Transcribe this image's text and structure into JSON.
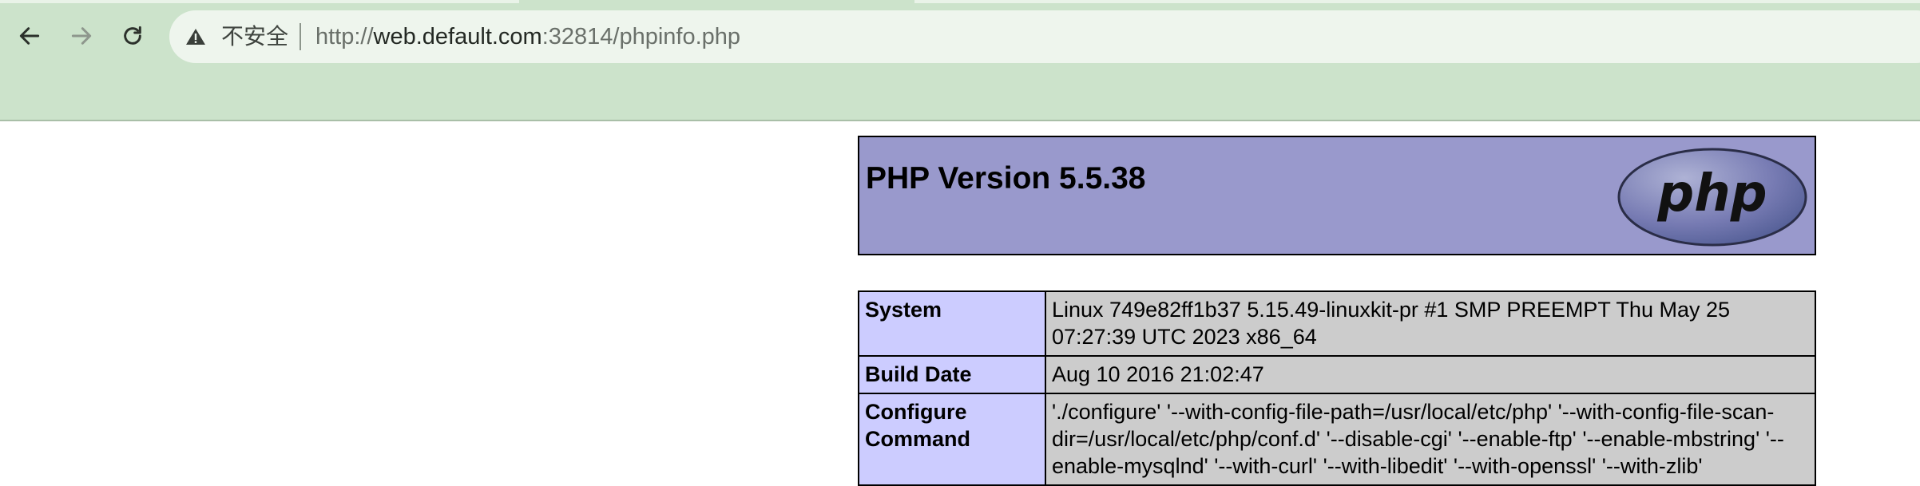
{
  "browser": {
    "security_label": "不安全",
    "url_scheme": "http://",
    "url_host": "web.default.com",
    "url_rest": ":32814/phpinfo.php",
    "icons": [
      "back-arrow-icon",
      "forward-arrow-icon",
      "reload-icon",
      "warning-icon"
    ]
  },
  "php": {
    "title": "PHP Version 5.5.38",
    "logo_text": "php",
    "rows": [
      {
        "key": "System",
        "value": "Linux 749e82ff1b37 5.15.49-linuxkit-pr #1 SMP PREEMPT Thu May 25 07:27:39 UTC 2023 x86_64"
      },
      {
        "key": "Build Date",
        "value": "Aug 10 2016 21:02:47"
      },
      {
        "key": "Configure Command",
        "value": "'./configure' '--with-config-file-path=/usr/local/etc/php' '--with-config-file-scan-dir=/usr/local/etc/php/conf.d' '--disable-cgi' '--enable-ftp' '--enable-mbstring' '--enable-mysqlnd' '--with-curl' '--with-libedit' '--with-openssl' '--with-zlib'"
      }
    ]
  },
  "colors": {
    "chrome_bg": "#cce3cb",
    "omnibox_bg": "#eef5ed",
    "php_header": "#9999cc",
    "key_cell": "#ccccff",
    "value_cell": "#cccccc"
  }
}
